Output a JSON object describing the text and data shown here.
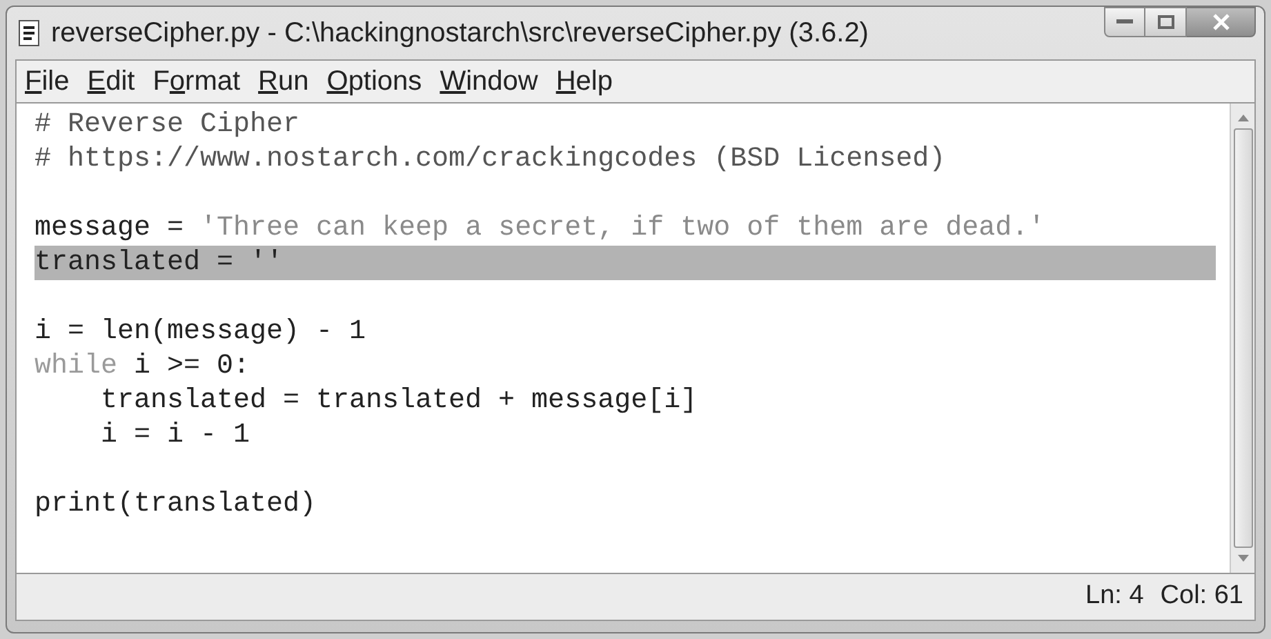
{
  "window": {
    "title": "reverseCipher.py - C:\\hackingnostarch\\src\\reverseCipher.py (3.6.2)"
  },
  "menu": [
    {
      "key": "F",
      "after": "ile"
    },
    {
      "key": "E",
      "after": "dit"
    },
    {
      "before": "F",
      "key": "o",
      "after": "rmat"
    },
    {
      "key": "R",
      "after": "un"
    },
    {
      "key": "O",
      "after": "ptions"
    },
    {
      "key": "W",
      "after": "indow"
    },
    {
      "key": "H",
      "after": "elp"
    }
  ],
  "editor": {
    "lines": [
      {
        "kind": "code",
        "selected": false,
        "tokens": [
          {
            "kind": "comment",
            "text": "# Reverse Cipher"
          }
        ]
      },
      {
        "kind": "code",
        "selected": false,
        "tokens": [
          {
            "kind": "comment",
            "text": "# https://www.nostarch.com/crackingcodes (BSD Licensed)"
          }
        ]
      },
      {
        "kind": "blank"
      },
      {
        "kind": "code",
        "selected": false,
        "tokens": [
          {
            "kind": "plain",
            "text": "message = "
          },
          {
            "kind": "string",
            "text": "'Three can keep a secret, if two of them are dead.'"
          }
        ]
      },
      {
        "kind": "code",
        "selected": true,
        "tokens": [
          {
            "kind": "plain",
            "text": "translated = ''"
          }
        ]
      },
      {
        "kind": "blank"
      },
      {
        "kind": "code",
        "selected": false,
        "tokens": [
          {
            "kind": "plain",
            "text": "i = len(message) - 1"
          }
        ]
      },
      {
        "kind": "code",
        "selected": false,
        "tokens": [
          {
            "kind": "keyword",
            "text": "while"
          },
          {
            "kind": "plain",
            "text": " i >= 0:"
          }
        ]
      },
      {
        "kind": "code",
        "selected": false,
        "tokens": [
          {
            "kind": "plain",
            "text": "    translated = translated + message[i]"
          }
        ]
      },
      {
        "kind": "code",
        "selected": false,
        "tokens": [
          {
            "kind": "plain",
            "text": "    i = i - 1"
          }
        ]
      },
      {
        "kind": "blank"
      },
      {
        "kind": "code",
        "selected": false,
        "tokens": [
          {
            "kind": "plain",
            "text": "print(translated)"
          }
        ]
      }
    ]
  },
  "status_bar": {
    "line": "Ln: 4",
    "column": "Col: 61"
  }
}
